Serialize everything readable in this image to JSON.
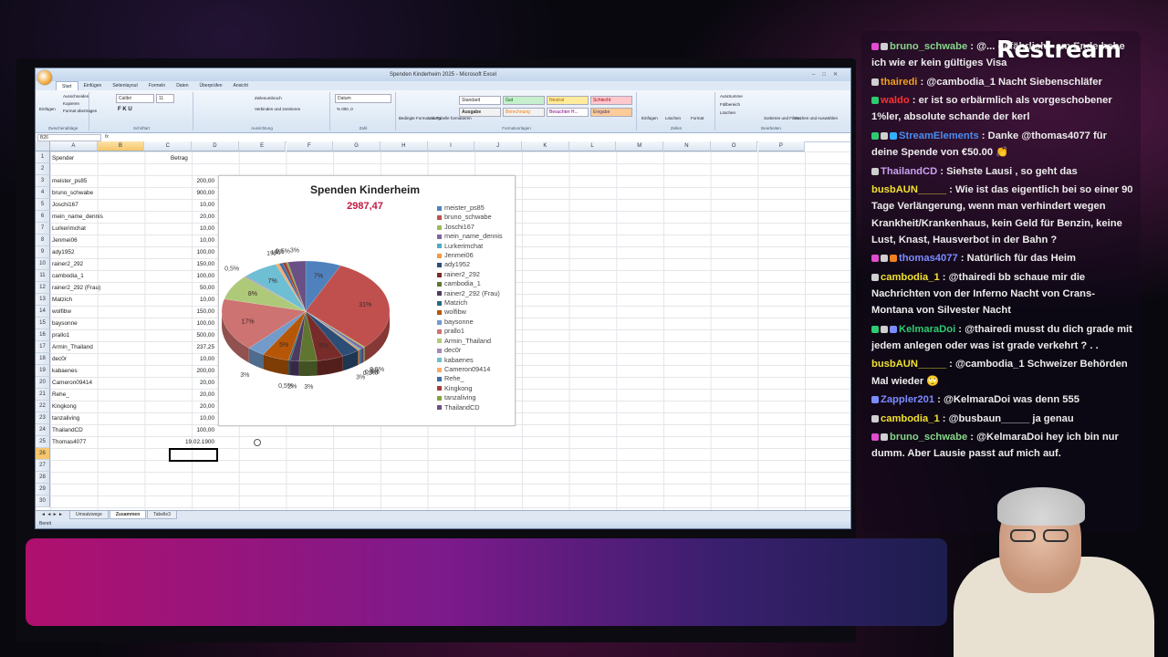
{
  "stream": {
    "logo_text": "Restream",
    "banner_color": "#b0106e"
  },
  "excel": {
    "window_title": "Spenden Kinderheim 2025 - Microsoft Excel",
    "ribbon_tabs": [
      "Start",
      "Einfügen",
      "Seitenlayout",
      "Formeln",
      "Daten",
      "Überprüfen",
      "Ansicht"
    ],
    "active_tab": "Start",
    "ribbon": {
      "paste": "Einfügen",
      "cut": "Ausschneiden",
      "copy": "Kopieren",
      "format_painter": "Format übertragen",
      "clipboard": "Zwischenablage",
      "font_name": "Calibri",
      "font_size": "11",
      "font_group": "Schriftart",
      "wrap": "Zeilenumbruch",
      "merge": "Verbinden und zentrieren",
      "align_group": "Ausrichtung",
      "number_format": "Datum",
      "number_group": "Zahl",
      "cond_format": "Bedingte Formatierung",
      "as_table": "Als Tabelle formatieren",
      "styles_group": "Formatvorlagen",
      "style_standard": "Standard",
      "style_gut": "Gut",
      "style_neutral": "Neutral",
      "style_schlecht": "Schlecht",
      "style_ausgabe": "Ausgabe",
      "style_berechnung": "Berechnung",
      "style_besucht": "Besuchter H...",
      "style_eingabe": "Eingabe",
      "insert_cells": "Einfügen",
      "delete_cells": "Löschen",
      "format_cells": "Format",
      "cells_group": "Zellen",
      "autosum": "AutoSumme",
      "fill": "Füllbereich",
      "clear": "Löschen",
      "sort": "Sortieren und Filtern",
      "find": "Suchen und Auswählen",
      "edit_group": "Bearbeiten"
    },
    "name_box": "B26",
    "formula_fx": "fx",
    "columns": [
      "A",
      "B",
      "C",
      "D",
      "E",
      "F",
      "G",
      "H",
      "I",
      "J",
      "K",
      "L",
      "M",
      "N",
      "O",
      "P"
    ],
    "row_numbers": [
      1,
      2,
      3,
      4,
      5,
      6,
      7,
      8,
      9,
      10,
      11,
      12,
      13,
      14,
      15,
      16,
      17,
      18,
      19,
      20,
      21,
      22,
      23,
      24,
      25,
      26,
      27,
      28,
      29,
      30
    ],
    "header_spender": "Spender",
    "header_betrag": "Betrag",
    "rows": [
      {
        "name": "meister_ps85",
        "amount": "200,00"
      },
      {
        "name": "bruno_schwabe",
        "amount": "900,00"
      },
      {
        "name": "Joschi167",
        "amount": "10,00"
      },
      {
        "name": "mein_name_dennis",
        "amount": "20,00"
      },
      {
        "name": "Lurkerimchat",
        "amount": "10,00"
      },
      {
        "name": "Jenmei06",
        "amount": "10,00"
      },
      {
        "name": "ady1952",
        "amount": "100,00"
      },
      {
        "name": "rainer2_292",
        "amount": "150,00"
      },
      {
        "name": "cambodia_1",
        "amount": "100,00"
      },
      {
        "name": "rainer2_292 (Frau)",
        "amount": "50,00"
      },
      {
        "name": "Matzich",
        "amount": "10,00"
      },
      {
        "name": "wolfibw",
        "amount": "150,00"
      },
      {
        "name": "baysonne",
        "amount": "100,00"
      },
      {
        "name": "prallo1",
        "amount": "500,00"
      },
      {
        "name": "Armin_Thailand",
        "amount": "237,25"
      },
      {
        "name": "dec0r",
        "amount": "10,00"
      },
      {
        "name": "kabaenes",
        "amount": "200,00"
      },
      {
        "name": "Cameron09414",
        "amount": "20,00"
      },
      {
        "name": "Rehe_",
        "amount": "20,00"
      },
      {
        "name": "Kingkong",
        "amount": "20,00"
      },
      {
        "name": "tanzaliving",
        "amount": "10,00"
      },
      {
        "name": "ThailandCD",
        "amount": "100,00"
      },
      {
        "name": "Thomas4077",
        "amount": "19.02.1900"
      }
    ],
    "sheet_tabs": [
      "Umsatzwege",
      "Zusammen",
      "Tabelle3"
    ],
    "active_sheet": "Zusammen",
    "status": "Bereit"
  },
  "chart_data": {
    "type": "pie",
    "title": "Spenden Kinderheim",
    "subtitle": "2987,47",
    "categories": [
      "meister_ps85",
      "bruno_schwabe",
      "Joschi167",
      "mein_name_dennis",
      "Lurkerimchat",
      "Jenmei06",
      "ady1952",
      "rainer2_292",
      "cambodia_1",
      "rainer2_292 (Frau)",
      "Matzich",
      "wolfibw",
      "baysonne",
      "prallo1",
      "Armin_Thailand",
      "dec0r",
      "kabaenes",
      "Cameron09414",
      "Rehe_",
      "Kingkong",
      "tanzaliving",
      "ThailandCD"
    ],
    "values": [
      200,
      900,
      10,
      20,
      10,
      10,
      100,
      150,
      100,
      50,
      10,
      150,
      100,
      500,
      237.25,
      10,
      200,
      20,
      20,
      20,
      10,
      100
    ],
    "data_labels": [
      "7%",
      "31%",
      "0,5%",
      "1%",
      "0,5%",
      "0,5%",
      "3%",
      "5%",
      "3%",
      "2%",
      "0,5%",
      "5%",
      "3%",
      "17%",
      "8%",
      "0,5%",
      "7%",
      "1%",
      "1%",
      "1%",
      "0,5%",
      "3%"
    ],
    "colors": [
      "#4f81bd",
      "#c0504d",
      "#9bbb59",
      "#8064a2",
      "#4bacc6",
      "#f79646",
      "#2c4d75",
      "#772c2a",
      "#5f7530",
      "#4d3b62",
      "#276a7c",
      "#b65708",
      "#729aca",
      "#cd7371",
      "#afc97a",
      "#a08cb8",
      "#6ebed4",
      "#f9ab6b",
      "#3d6da4",
      "#a33d3a",
      "#83a33e",
      "#6a5084"
    ],
    "legend_position": "right"
  },
  "chat": {
    "messages": [
      {
        "user": "bruno_schwabe",
        "color": "#86d68a",
        "badges": [
          "#e24bd0",
          "#cfcfcf"
        ],
        "text": ": @... gefährlich - am Ende habe ich wie er kein gültiges Visa"
      },
      {
        "user": "thairedi",
        "color": "#f0a020",
        "badges": [
          "#cfcfcf"
        ],
        "text": ": @cambodia_1 Nacht Siebenschläfer"
      },
      {
        "user": "waldo",
        "color": "#ff3030",
        "badges": [
          "#2ecc71"
        ],
        "text": ": er ist so erbärmlich als vorgeschobener 1%ler, absolute schande der kerl"
      },
      {
        "user": "StreamElements",
        "color": "#4a8df0",
        "badges": [
          "#2ecc71",
          "#cfcfcf",
          "#30b0ff"
        ],
        "text": ": Danke @thomas4077 für deine Spende von €50.00 👏"
      },
      {
        "user": "ThailandCD",
        "color": "#c9a0f0",
        "badges": [
          "#cfcfcf"
        ],
        "text": ": Siehste Lausi , so geht das"
      },
      {
        "user": "busbAUN_____",
        "color": "#f0e030",
        "badges": [],
        "text": ": Wie ist das eigentlich bei so einer 90 Tage Verlängerung, wenn man verhindert wegen Krankheit/Krankenhaus, kein Geld für Benzin, keine Lust, Knast, Hausverbot in der Bahn ?"
      },
      {
        "user": "thomas4077",
        "color": "#7b8cff",
        "badges": [
          "#e24bd0",
          "#cfcfcf",
          "#f08020"
        ],
        "text": ": Natürlich für das Heim"
      },
      {
        "user": "cambodia_1",
        "color": "#f0e030",
        "badges": [
          "#cfcfcf"
        ],
        "text": ": @thairedi bb schaue mir die Nachrichten von der Inferno Nacht von Crans-Montana von Silvester Nacht"
      },
      {
        "user": "KelmaraDoi",
        "color": "#2ecc71",
        "badges": [
          "#2ecc71",
          "#cfcfcf",
          "#7b8cff"
        ],
        "text": ": @thairedi musst du dich grade mit jedem anlegen oder was ist grade verkehrt ? . ."
      },
      {
        "user": "busbAUN_____",
        "color": "#f0e030",
        "badges": [],
        "text": ": @cambodia_1 Schweizer Behörden Mal wieder 🙄"
      },
      {
        "user": "Zappler201",
        "color": "#7b8cff",
        "badges": [
          "#7b8cff"
        ],
        "text": ": @KelmaraDoi was denn 555"
      },
      {
        "user": "cambodia_1",
        "color": "#f0e030",
        "badges": [
          "#cfcfcf"
        ],
        "text": ": @busbaun_____ ja genau"
      },
      {
        "user": "bruno_schwabe",
        "color": "#86d68a",
        "badges": [
          "#e24bd0",
          "#cfcfcf"
        ],
        "text": ": @KelmaraDoi hey ich bin nur dumm. Aber Lausie passt auf mich auf."
      }
    ]
  }
}
